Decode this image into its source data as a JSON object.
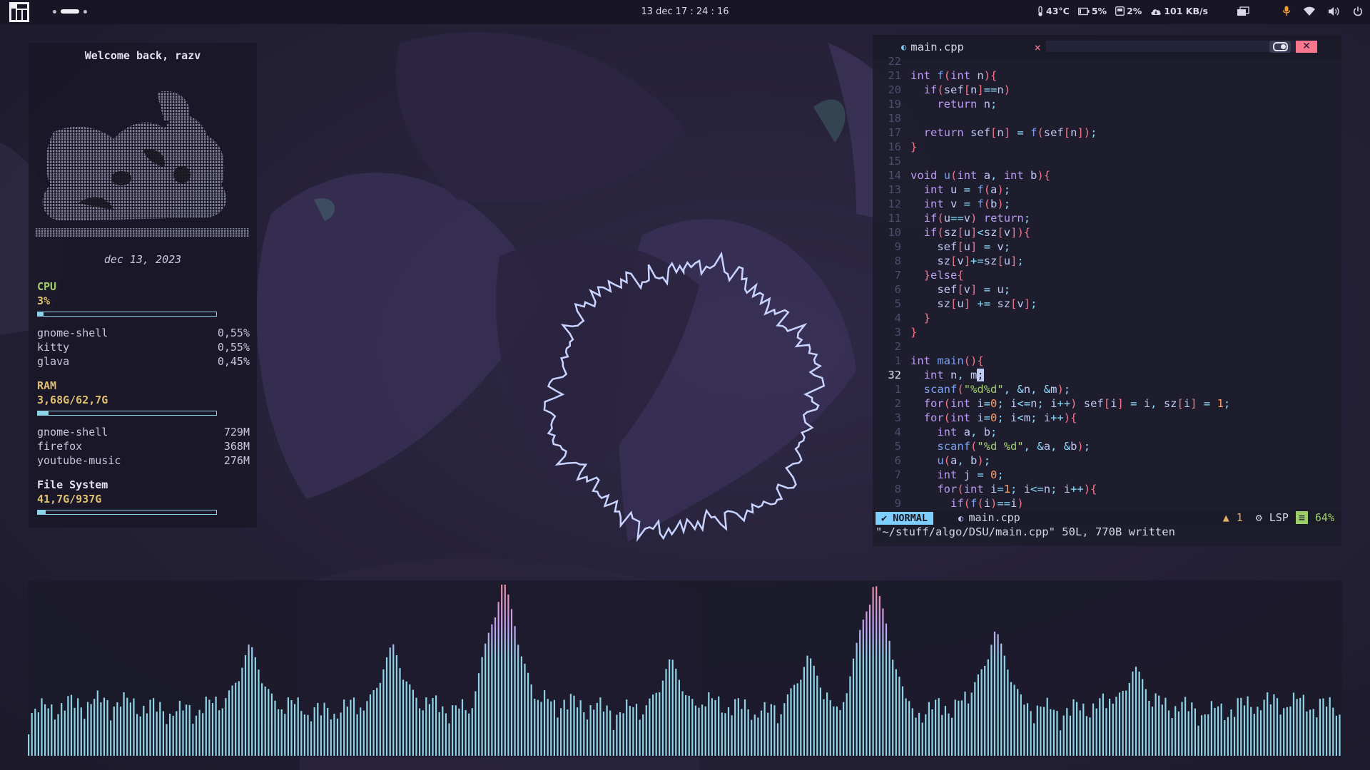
{
  "topbar": {
    "clock": "13 dec  17 : 24 : 16",
    "temperature": "43°C",
    "battery": "5%",
    "disk": "2%",
    "network": "101 KB/s"
  },
  "conky": {
    "welcome": "Welcome back, razv",
    "date": "dec 13, 2023",
    "cpu": {
      "title": "CPU",
      "value": "3%",
      "fill": 0.03,
      "procs": [
        {
          "name": "gnome-shell",
          "val": "0,55%"
        },
        {
          "name": "kitty",
          "val": "0,55%"
        },
        {
          "name": "glava",
          "val": "0,45%"
        }
      ]
    },
    "ram": {
      "title": "RAM",
      "value": "3,68G/62,7G",
      "fill": 0.06,
      "procs": [
        {
          "name": "gnome-shell",
          "val": "729M"
        },
        {
          "name": "firefox",
          "val": "368M"
        },
        {
          "name": "youtube-music",
          "val": "276M"
        }
      ]
    },
    "fs": {
      "title": "File System",
      "value": "41,7G/937G",
      "fill": 0.045
    }
  },
  "editor": {
    "tab_name": "main.cpp",
    "close_glyph": "×",
    "win_close_glyph": "✕",
    "lines": [
      {
        "n": "22",
        "cls": ""
      },
      {
        "n": "21",
        "cls": ""
      },
      {
        "n": "20",
        "cls": ""
      },
      {
        "n": "19",
        "cls": ""
      },
      {
        "n": "18",
        "cls": ""
      },
      {
        "n": "17",
        "cls": ""
      },
      {
        "n": "16",
        "cls": ""
      },
      {
        "n": "15",
        "cls": ""
      },
      {
        "n": "14",
        "cls": ""
      },
      {
        "n": "13",
        "cls": ""
      },
      {
        "n": "12",
        "cls": ""
      },
      {
        "n": "11",
        "cls": ""
      },
      {
        "n": "10",
        "cls": ""
      },
      {
        "n": "9",
        "cls": ""
      },
      {
        "n": "8",
        "cls": ""
      },
      {
        "n": "7",
        "cls": ""
      },
      {
        "n": "6",
        "cls": ""
      },
      {
        "n": "5",
        "cls": ""
      },
      {
        "n": "4",
        "cls": ""
      },
      {
        "n": "3",
        "cls": ""
      },
      {
        "n": "2",
        "cls": ""
      },
      {
        "n": "1",
        "cls": ""
      },
      {
        "n": "32",
        "cls": "cur"
      },
      {
        "n": "1",
        "cls": ""
      },
      {
        "n": "2",
        "cls": ""
      },
      {
        "n": "3",
        "cls": ""
      },
      {
        "n": "4",
        "cls": ""
      },
      {
        "n": "5",
        "cls": ""
      },
      {
        "n": "6",
        "cls": ""
      },
      {
        "n": "7",
        "cls": ""
      },
      {
        "n": "8",
        "cls": ""
      },
      {
        "n": "9",
        "cls": ""
      }
    ],
    "code": [
      "",
      "int f(int n){",
      "  if(sef[n]==n)",
      "    return n;",
      "",
      "  return sef[n] = f(sef[n]);",
      "}",
      "",
      "void u(int a, int b){",
      "  int u = f(a);",
      "  int v = f(b);",
      "  if(u==v) return;",
      "  if(sz[u]<sz[v]){",
      "    sef[u] = v;",
      "    sz[v]+=sz[u];",
      "  }else{",
      "    sef[v] = u;",
      "    sz[u] += sz[v];",
      "  }",
      "}",
      "",
      "int main(){",
      "  int n, m;",
      "  scanf(\"%d%d\", &n, &m);",
      "  for(int i=0; i<=n; i++) sef[i] = i, sz[i] = 1;",
      "  for(int i=0; i<m; i++){",
      "    int a, b;",
      "    scanf(\"%d %d\", &a, &b);",
      "    u(a, b);",
      "    int j = 0;",
      "    for(int i=1; i<=n; i++){",
      "      if(f(i)==i)"
    ],
    "mode": "NORMAL",
    "status_file": "main.cpp",
    "warnings": "1",
    "lsp": "LSP",
    "percent": "64%",
    "cmdline": "\"~/stuff/algo/DSU/main.cpp\" 50L, 770B written"
  },
  "colors": {
    "accent": "#8fd4e6",
    "viz_low": "#8fd4e6",
    "viz_mid": "#c4a0f0",
    "viz_high": "#f08a9a",
    "ring": "#c9d3ff"
  }
}
